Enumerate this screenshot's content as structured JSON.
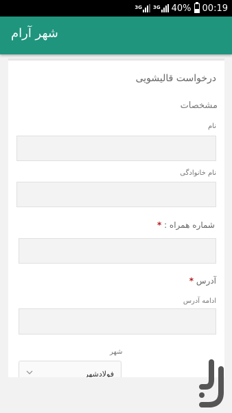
{
  "status_bar": {
    "network_1": "3G",
    "network_2": "3G",
    "battery_percent": "40%",
    "battery_level": 0.4,
    "time": "00:19"
  },
  "app_bar": {
    "title": "شهر آرام"
  },
  "form": {
    "title": "درخواست قالیشویی",
    "section_label": "مشخصات",
    "fields": {
      "first_name": {
        "label": "نام",
        "value": ""
      },
      "last_name": {
        "label": "نام خانوادگی",
        "value": ""
      },
      "mobile": {
        "label": "شماره همراه :",
        "required_mark": "*",
        "value": ""
      },
      "address": {
        "label": "آدرس",
        "required_mark": "*",
        "sub_label": "ادامه آدرس",
        "value": ""
      },
      "city": {
        "label": "شهر",
        "selected": "فولادشهر"
      }
    }
  },
  "icons": {
    "chevron": "chevron-down-icon",
    "battery": "battery-icon",
    "signal": "signal-icon",
    "notification": "notification-icon",
    "watermark": "store-logo-icon"
  },
  "colors": {
    "app_bar": "#1f957e",
    "required": "#b71c1c"
  }
}
